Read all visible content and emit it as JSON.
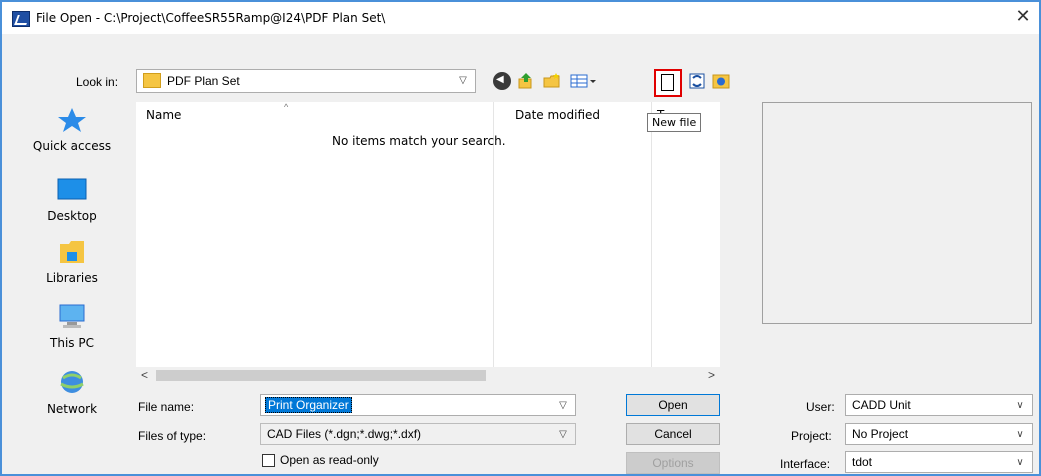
{
  "window": {
    "title": "File Open - C:\\Project\\CoffeeSR55Ramp@I24\\PDF Plan Set\\",
    "close_glyph": "✕"
  },
  "lookin": {
    "label": "Look in:",
    "value": "PDF Plan Set"
  },
  "toolbar": {
    "tooltip": "New file",
    "icons": [
      "back-icon",
      "up-folder-icon",
      "new-folder-icon",
      "views-menu-icon",
      "new-file-icon",
      "refresh-icon",
      "import-icon"
    ]
  },
  "places": [
    {
      "label": "Quick access",
      "icon": "star-icon"
    },
    {
      "label": "Desktop",
      "icon": "desktop-icon"
    },
    {
      "label": "Libraries",
      "icon": "libraries-icon"
    },
    {
      "label": "This PC",
      "icon": "computer-icon"
    },
    {
      "label": "Network",
      "icon": "network-icon"
    }
  ],
  "filelist": {
    "columns": [
      "Name",
      "Date modified",
      "T"
    ],
    "empty_message": "No items match your search."
  },
  "form": {
    "filename_label": "File name:",
    "filename_value": "Print Organizer",
    "filetype_label": "Files of type:",
    "filetype_value": "CAD Files (*.dgn;*.dwg;*.dxf)",
    "readonly_label": "Open as read-only"
  },
  "buttons": {
    "open": "Open",
    "cancel": "Cancel",
    "options": "Options"
  },
  "settings": {
    "user_label": "User:",
    "user_value": "CADD Unit",
    "project_label": "Project:",
    "project_value": "No Project",
    "interface_label": "Interface:",
    "interface_value": "tdot"
  },
  "colors": {
    "highlight_border": "#e00000",
    "selection": "#0078d7",
    "window_border": "#4a90d9"
  }
}
